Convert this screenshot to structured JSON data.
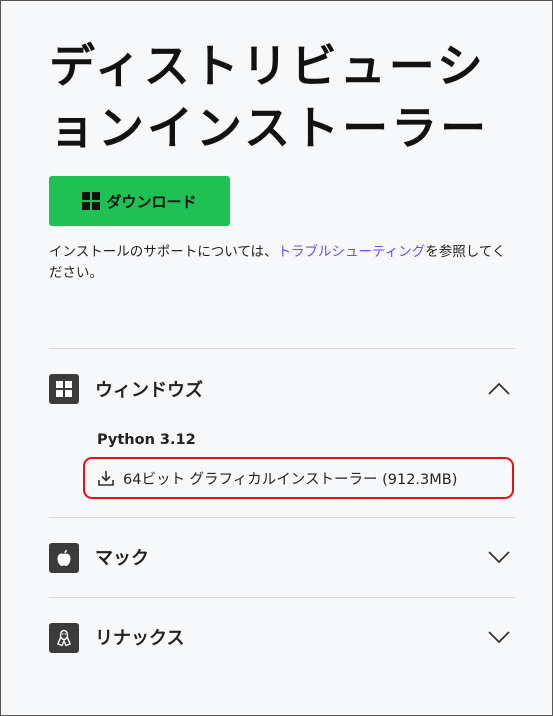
{
  "page": {
    "title_line1": "ディストリビューシ",
    "title_line2": "ョンインストーラー"
  },
  "download_button": {
    "label": "ダウンロード",
    "icon": "windows-icon",
    "color": "#1fc155"
  },
  "support_text": {
    "before": "インストールのサポートについては、",
    "link": "トラブルシューティング",
    "after": "を参照してください。",
    "link_color": "#6c4cff"
  },
  "sections": {
    "windows": {
      "label": "ウィンドウズ",
      "icon": "windows-icon",
      "expanded": true,
      "version": "Python 3.12",
      "installer_label": "64ビット グラフィカルインストーラー (912.3MB)",
      "installer_icon": "download-icon"
    },
    "mac": {
      "label": "マック",
      "icon": "apple-icon",
      "expanded": false
    },
    "linux": {
      "label": "リナックス",
      "icon": "linux-icon",
      "expanded": false
    }
  },
  "highlight_color": "#e3101a"
}
